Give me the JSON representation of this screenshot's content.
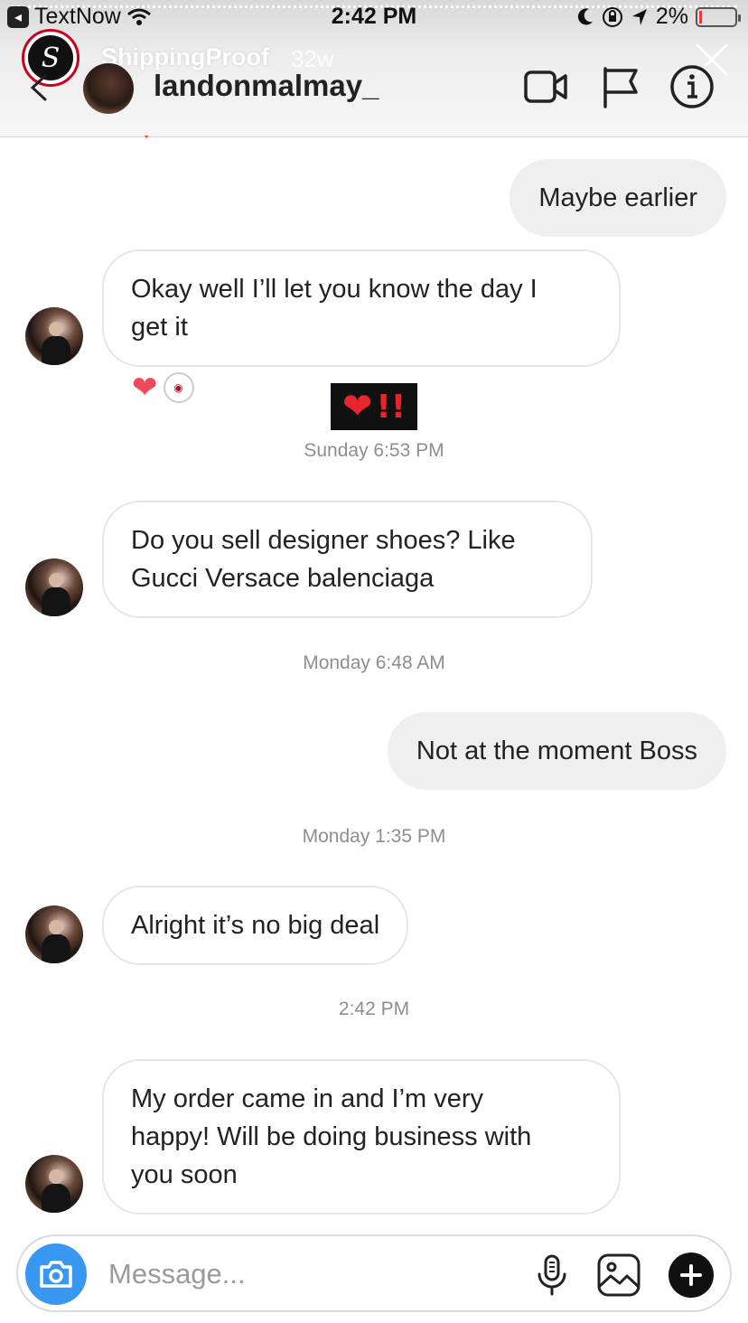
{
  "status_bar": {
    "app_name": "TextNow",
    "time": "2:42 PM",
    "battery": "2%"
  },
  "story": {
    "account_name": "ShippingProof",
    "age": "32w",
    "logo_letter": "S"
  },
  "conversation": {
    "username": "landonmalmay_"
  },
  "messages": [
    {
      "type": "outgoing",
      "text": "Maybe earlier"
    },
    {
      "type": "incoming",
      "line1": "Okay well I’ll let you know the day I",
      "line2": "get it"
    },
    {
      "type": "timestamp",
      "text": "Sunday 6:53 PM"
    },
    {
      "type": "incoming",
      "line1": "Do you sell designer shoes? Like",
      "line2": "Gucci Versace balenciaga"
    },
    {
      "type": "timestamp",
      "text": "Monday 6:48 AM"
    },
    {
      "type": "outgoing",
      "text": "Not at the moment Boss"
    },
    {
      "type": "timestamp",
      "text": "Monday 1:35 PM"
    },
    {
      "type": "incoming",
      "text": "Alright it’s no big deal"
    },
    {
      "type": "timestamp",
      "text": "2:42 PM"
    },
    {
      "type": "incoming",
      "line1": "My order came in and I’m very",
      "line2": "happy! Will be doing business with",
      "line3": "you soon"
    }
  ],
  "reactions": {
    "heart": "❤",
    "sticker_bang": "!!"
  },
  "composer": {
    "placeholder": "Message..."
  },
  "colors": {
    "accent_blue": "#3897f0",
    "heart_red": "#ed4956",
    "outgoing_bubble": "#efefef",
    "timestamp_gray": "#8e8e8e"
  },
  "icons": [
    "back-chevron-icon",
    "video-call-icon",
    "flag-icon",
    "info-icon",
    "close-icon",
    "camera-icon",
    "microphone-icon",
    "gallery-icon",
    "plus-icon",
    "wifi-icon",
    "moon-icon",
    "orientation-lock-icon",
    "location-icon",
    "battery-icon"
  ]
}
